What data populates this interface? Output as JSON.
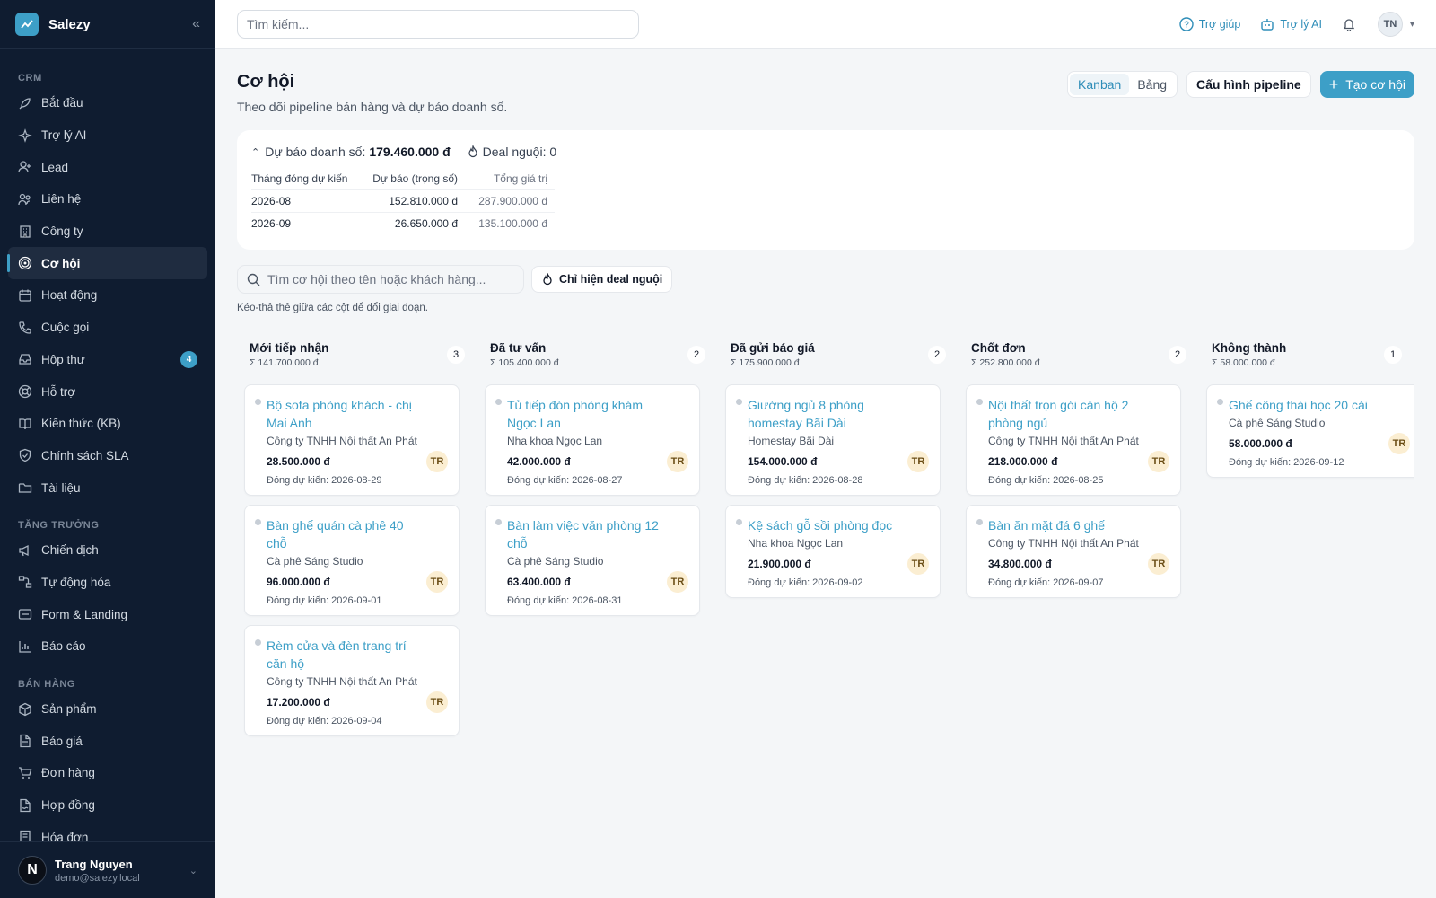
{
  "app": {
    "name": "Salezy",
    "collapse_icon": "«"
  },
  "sidebar": {
    "sections": [
      {
        "title": "CRM",
        "items": [
          {
            "label": "Bắt đầu",
            "icon": "rocket-icon"
          },
          {
            "label": "Trợ lý AI",
            "icon": "sparkles-icon"
          },
          {
            "label": "Lead",
            "icon": "user-plus-icon"
          },
          {
            "label": "Liên hệ",
            "icon": "users-icon"
          },
          {
            "label": "Công ty",
            "icon": "building-icon"
          },
          {
            "label": "Cơ hội",
            "icon": "target-icon",
            "active": true
          },
          {
            "label": "Hoạt động",
            "icon": "calendar-icon"
          },
          {
            "label": "Cuộc gọi",
            "icon": "phone-icon"
          },
          {
            "label": "Hộp thư",
            "icon": "inbox-icon",
            "badge": "4"
          },
          {
            "label": "Hỗ trợ",
            "icon": "lifebuoy-icon"
          },
          {
            "label": "Kiến thức (KB)",
            "icon": "book-icon"
          },
          {
            "label": "Chính sách SLA",
            "icon": "shield-icon"
          },
          {
            "label": "Tài liệu",
            "icon": "folder-icon"
          }
        ]
      },
      {
        "title": "TĂNG TRƯỞNG",
        "items": [
          {
            "label": "Chiến dịch",
            "icon": "megaphone-icon"
          },
          {
            "label": "Tự động hóa",
            "icon": "workflow-icon"
          },
          {
            "label": "Form & Landing",
            "icon": "form-icon"
          },
          {
            "label": "Báo cáo",
            "icon": "bar-chart-icon"
          }
        ]
      },
      {
        "title": "BÁN HÀNG",
        "items": [
          {
            "label": "Sản phẩm",
            "icon": "package-icon"
          },
          {
            "label": "Báo giá",
            "icon": "file-text-icon"
          },
          {
            "label": "Đơn hàng",
            "icon": "cart-icon"
          },
          {
            "label": "Hợp đồng",
            "icon": "contract-icon"
          },
          {
            "label": "Hóa đơn",
            "icon": "receipt-icon"
          }
        ]
      }
    ],
    "user": {
      "initial": "N",
      "name": "Trang Nguyen",
      "email": "demo@salezy.local"
    }
  },
  "topbar": {
    "search_placeholder": "Tìm kiếm...",
    "help_label": "Trợ giúp",
    "ai_label": "Trợ lý AI",
    "avatar_initials": "TN"
  },
  "page": {
    "title": "Cơ hội",
    "subtitle": "Theo dõi pipeline bán hàng và dự báo doanh số.",
    "view_kanban": "Kanban",
    "view_table": "Bảng",
    "config_button": "Cấu hình pipeline",
    "create_button": "Tạo cơ hội"
  },
  "forecast": {
    "label": "Dự báo doanh số:",
    "value": "179.460.000 đ",
    "cold_label": "Deal nguội: 0",
    "headers": [
      "Tháng đóng dự kiến",
      "Dự báo (trọng số)",
      "Tổng giá trị"
    ],
    "rows": [
      [
        "2026-08",
        "152.810.000 đ",
        "287.900.000 đ"
      ],
      [
        "2026-09",
        "26.650.000 đ",
        "135.100.000 đ"
      ]
    ]
  },
  "filters": {
    "search_placeholder": "Tìm cơ hội theo tên hoặc khách hàng...",
    "cold_only": "Chỉ hiện deal nguội",
    "hint": "Kéo-thả thẻ giữa các cột để đổi giai đoạn."
  },
  "board": {
    "columns": [
      {
        "title": "Mới tiếp nhận",
        "sum": "Σ 141.700.000 đ",
        "count": "3",
        "cards": [
          {
            "title": "Bộ sofa phòng khách - chị Mai Anh",
            "company": "Công ty TNHH Nội thất An Phát",
            "value": "28.500.000 đ",
            "owner": "TR",
            "close": "Đóng dự kiến: 2026-08-29"
          },
          {
            "title": "Bàn ghế quán cà phê 40 chỗ",
            "company": "Cà phê Sáng Studio",
            "value": "96.000.000 đ",
            "owner": "TR",
            "close": "Đóng dự kiến: 2026-09-01"
          },
          {
            "title": "Rèm cửa và đèn trang trí căn hộ",
            "company": "Công ty TNHH Nội thất An Phát",
            "value": "17.200.000 đ",
            "owner": "TR",
            "close": "Đóng dự kiến: 2026-09-04"
          }
        ]
      },
      {
        "title": "Đã tư vấn",
        "sum": "Σ 105.400.000 đ",
        "count": "2",
        "cards": [
          {
            "title": "Tủ tiếp đón phòng khám Ngọc Lan",
            "company": "Nha khoa Ngọc Lan",
            "value": "42.000.000 đ",
            "owner": "TR",
            "close": "Đóng dự kiến: 2026-08-27"
          },
          {
            "title": "Bàn làm việc văn phòng 12 chỗ",
            "company": "Cà phê Sáng Studio",
            "value": "63.400.000 đ",
            "owner": "TR",
            "close": "Đóng dự kiến: 2026-08-31"
          }
        ]
      },
      {
        "title": "Đã gửi báo giá",
        "sum": "Σ 175.900.000 đ",
        "count": "2",
        "cards": [
          {
            "title": "Giường ngủ 8 phòng homestay Bãi Dài",
            "company": "Homestay Bãi Dài",
            "value": "154.000.000 đ",
            "owner": "TR",
            "close": "Đóng dự kiến: 2026-08-28"
          },
          {
            "title": "Kệ sách gỗ sồi phòng đọc",
            "company": "Nha khoa Ngọc Lan",
            "value": "21.900.000 đ",
            "owner": "TR",
            "close": "Đóng dự kiến: 2026-09-02"
          }
        ]
      },
      {
        "title": "Chốt đơn",
        "sum": "Σ 252.800.000 đ",
        "count": "2",
        "cards": [
          {
            "title": "Nội thất trọn gói căn hộ 2 phòng ngủ",
            "company": "Công ty TNHH Nội thất An Phát",
            "value": "218.000.000 đ",
            "owner": "TR",
            "close": "Đóng dự kiến: 2026-08-25"
          },
          {
            "title": "Bàn ăn mặt đá 6 ghế",
            "company": "Công ty TNHH Nội thất An Phát",
            "value": "34.800.000 đ",
            "owner": "TR",
            "close": "Đóng dự kiến: 2026-09-07"
          }
        ]
      },
      {
        "title": "Không thành",
        "sum": "Σ 58.000.000 đ",
        "count": "1",
        "cards": [
          {
            "title": "Ghế công thái học 20 cái",
            "company": "Cà phê Sáng Studio",
            "value": "58.000.000 đ",
            "owner": "TR",
            "close": "Đóng dự kiến: 2026-09-12"
          }
        ]
      }
    ]
  },
  "colors": {
    "accent": "#3d9fc7",
    "sidebar_bg": "#0f1c30",
    "page_bg": "#f4f6f8"
  }
}
